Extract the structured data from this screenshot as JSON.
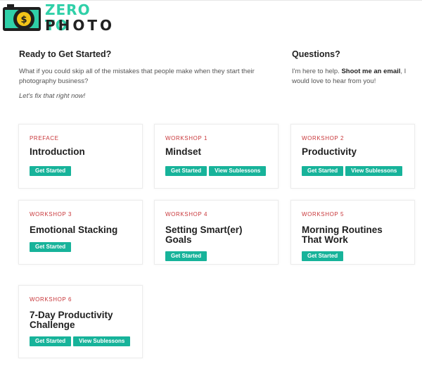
{
  "logo": {
    "line1": "ZERO TO",
    "line2": "PHOTO"
  },
  "intro": {
    "heading": "Ready to Get Started?",
    "body": "What if you could skip all of the mistakes that people make when they start their photography business?",
    "tagline": "Let's fix that right now!"
  },
  "questions": {
    "heading": "Questions?",
    "body_before": "I'm here to help. ",
    "email_link": "Shoot me an email",
    "body_after": ", I would love to hear from you!"
  },
  "buttons": {
    "get_started": "Get Started",
    "view_sublessons": "View Sublessons"
  },
  "cards": [
    {
      "label": "PREFACE",
      "title": "Introduction",
      "has_sublessons": false
    },
    {
      "label": "WORKSHOP 1",
      "title": "Mindset",
      "has_sublessons": true
    },
    {
      "label": "WORKSHOP 2",
      "title": "Productivity",
      "has_sublessons": true
    },
    {
      "label": "WORKSHOP 3",
      "title": "Emotional Stacking",
      "has_sublessons": false
    },
    {
      "label": "WORKSHOP 4",
      "title": "Setting Smart(er) Goals",
      "has_sublessons": false
    },
    {
      "label": "WORKSHOP 5",
      "title": "Morning Routines That Work",
      "has_sublessons": false
    },
    {
      "label": "WORKSHOP 6",
      "title": "7-Day Productivity Challenge",
      "has_sublessons": true
    }
  ],
  "colors": {
    "accent": "#17b39a",
    "label_red": "#c8373a",
    "logo_green": "#2fd0a8"
  }
}
